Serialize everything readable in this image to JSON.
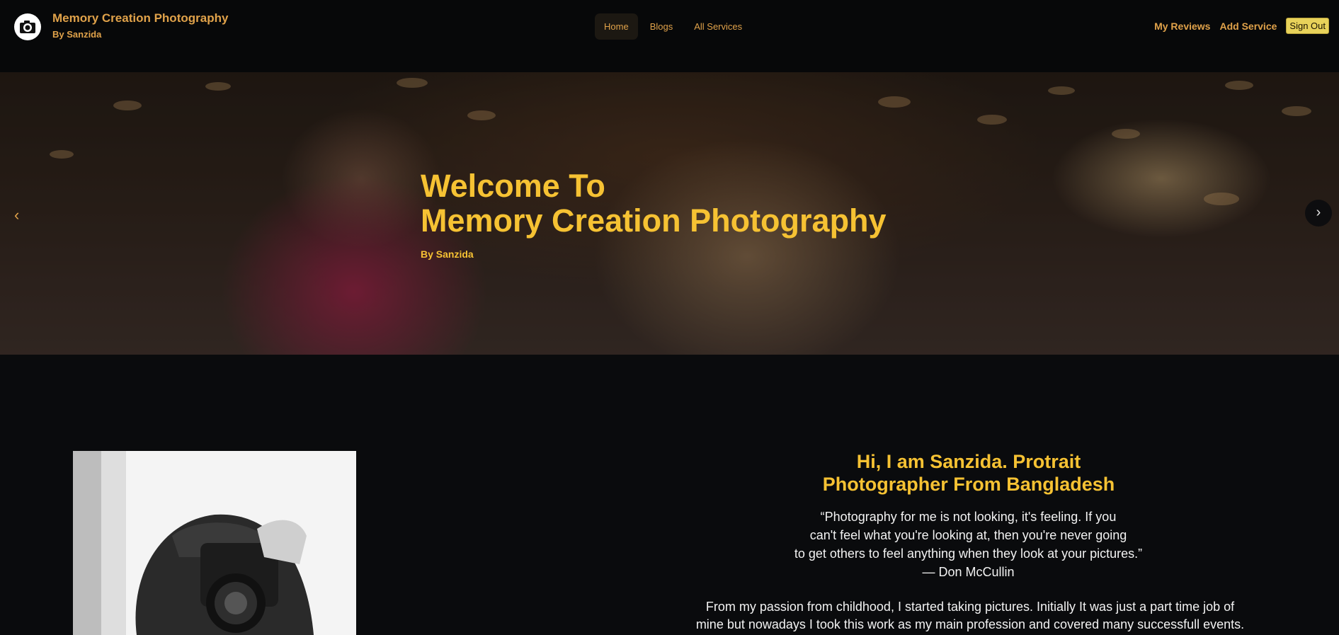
{
  "nav": {
    "brand_title": "Memory Creation Photography",
    "brand_subtitle": "By Sanzida",
    "links": [
      {
        "label": "Home",
        "active": true
      },
      {
        "label": "Blogs",
        "active": false
      },
      {
        "label": "All Services",
        "active": false
      }
    ],
    "right_links": [
      "My Reviews",
      "Add Service"
    ],
    "signout_label": "Sign Out",
    "accent_color": "#e0a24a"
  },
  "hero": {
    "title_line1": "Welcome To",
    "title_line2": "Memory Creation Photography",
    "by_line": "By Sanzida",
    "prev_arrow": "‹",
    "next_arrow": "›",
    "title_color": "#f6c233"
  },
  "about": {
    "heading": "Hi, I am Sanzida. Protrait Photographer From Bangladesh",
    "quote_lines": [
      "“Photography for me is not looking, it's feeling. If you",
      "can't feel what you're looking at, then you're never going",
      "to get others to feel anything when they look at your pictures.”",
      "— Don McCullin"
    ],
    "paragraph_lines": [
      "From my passion from childhood, I started taking pictures. Initially It was just a part time job of",
      "mine but nowadays I took this work as my main profession and covered many successfull events."
    ]
  },
  "icons": {
    "logo": "camera-logo-icon",
    "prev": "chevron-left-icon",
    "next": "chevron-right-icon"
  }
}
